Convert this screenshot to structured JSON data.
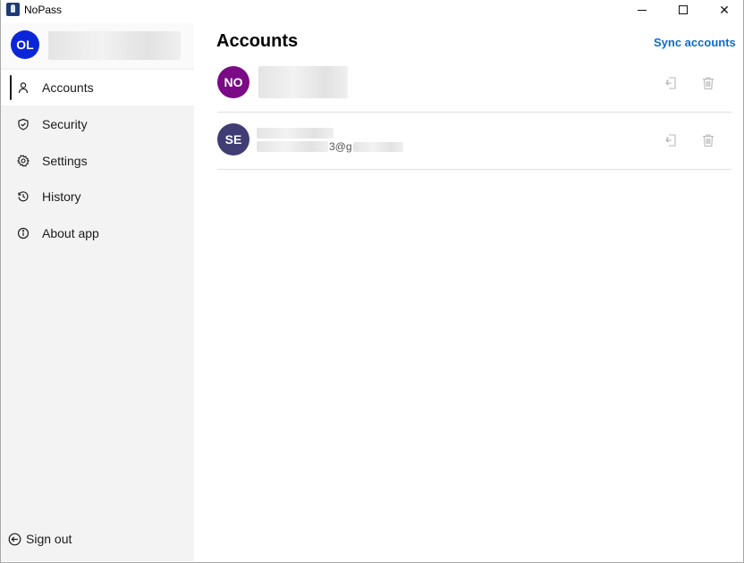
{
  "window": {
    "title": "NoPass",
    "controls": {
      "minimize": "minimize",
      "maximize": "maximize",
      "close": "✕"
    }
  },
  "profile": {
    "initials": "OL",
    "avatar_color": "#0b26d8",
    "name": ""
  },
  "sidebar": {
    "items": [
      {
        "label": "Accounts",
        "icon": "person-icon",
        "active": true
      },
      {
        "label": "Security",
        "icon": "shield-icon",
        "active": false
      },
      {
        "label": "Settings",
        "icon": "gear-icon",
        "active": false
      },
      {
        "label": "History",
        "icon": "history-icon",
        "active": false
      },
      {
        "label": "About app",
        "icon": "info-icon",
        "active": false
      }
    ],
    "signout_label": "Sign out"
  },
  "main": {
    "title": "Accounts",
    "sync_label": "Sync accounts",
    "accent_color": "#0a6cd0",
    "accounts": [
      {
        "initials": "NO",
        "avatar_color": "#7a0a86",
        "name": "",
        "email": ""
      },
      {
        "initials": "SE",
        "avatar_color": "#3f3d73",
        "name": "",
        "email_fragment": "3@g"
      }
    ]
  }
}
